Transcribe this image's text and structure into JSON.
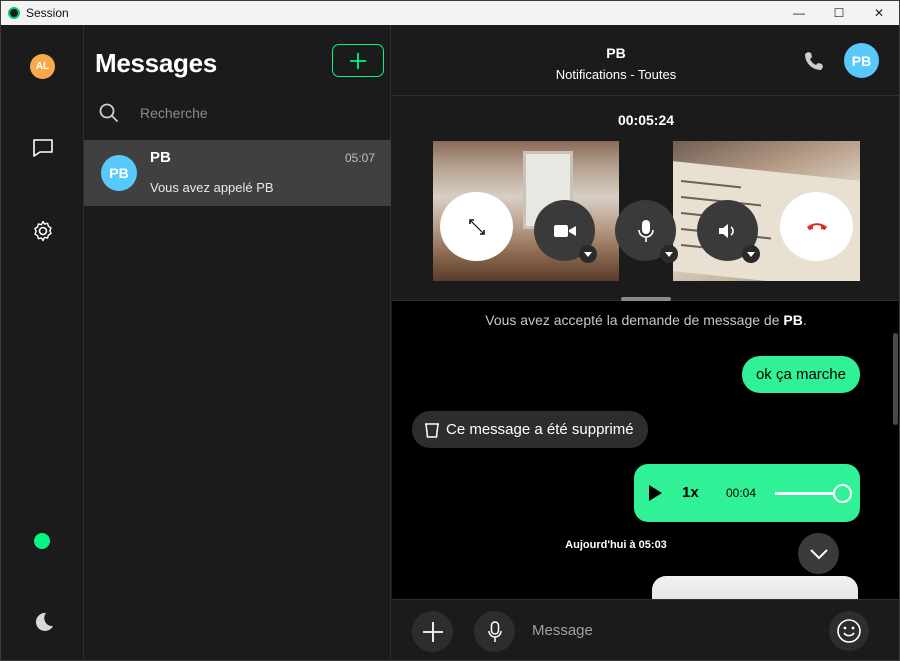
{
  "window": {
    "title": "Session",
    "controls": {
      "minimize": "—",
      "maximize": "☐",
      "close": "✕"
    }
  },
  "rail": {
    "avatar_initials": "AL",
    "avatar_color": "#f9a84a",
    "online_color": "#00f782"
  },
  "list": {
    "title": "Messages",
    "search_placeholder": "Recherche",
    "conversations": [
      {
        "initials": "PB",
        "name": "PB",
        "time": "05:07",
        "snippet": "Vous avez appelé PB"
      }
    ]
  },
  "chat": {
    "header": {
      "name": "PB",
      "subtitle": "Notifications - Toutes",
      "avatar_initials": "PB"
    },
    "call": {
      "timer": "00:05:24"
    },
    "notice": {
      "before": "Vous avez accepté la demande de message de ",
      "name": "PB",
      "after": "."
    },
    "messages": {
      "outgoing_text": "ok ça marche",
      "deleted_text": "Ce message a été supprimé",
      "audio": {
        "rate": "1x",
        "duration": "00:04",
        "progress": 1.0
      }
    },
    "day_separator": "Aujourd'hui à 05:03",
    "composer": {
      "placeholder": "Message"
    }
  },
  "colors": {
    "accent": "#31f196",
    "avatar_blue": "#57c9fa",
    "hangup_red": "#e02b2b"
  }
}
